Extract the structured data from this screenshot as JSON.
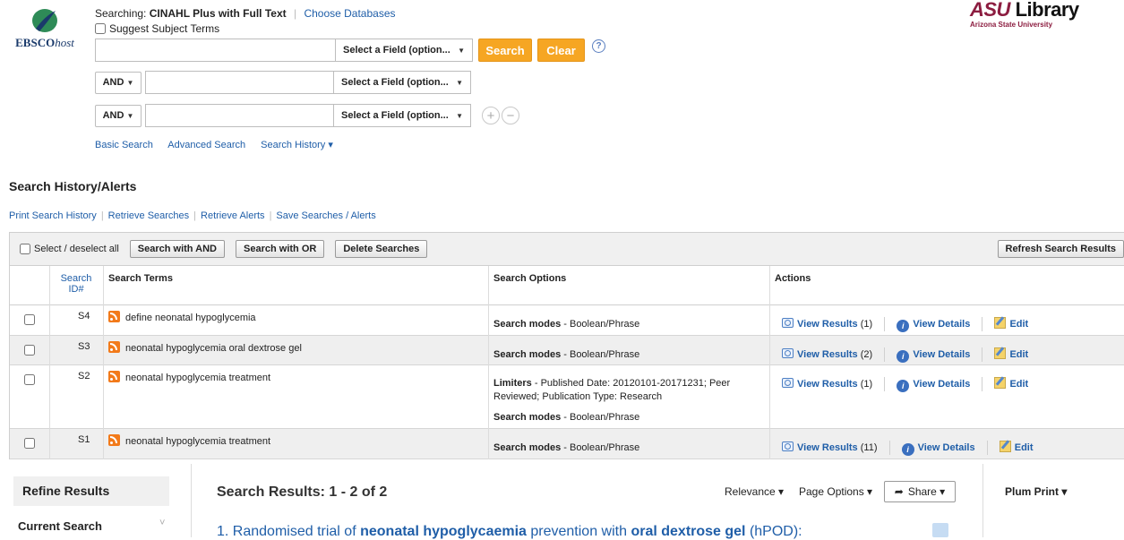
{
  "header": {
    "searching_label": "Searching:",
    "database": "CINAHL Plus with Full Text",
    "choose_databases": "Choose Databases",
    "suggest_subject_terms": "Suggest Subject Terms",
    "logo_text": "EBSCO",
    "logo_text_italic": "host"
  },
  "asu": {
    "logo_asu": "ASU",
    "logo_library": "Library",
    "subtitle": "Arizona State University"
  },
  "search_rows": [
    {
      "bool": "",
      "value": "",
      "field": "Select a Field (option..."
    },
    {
      "bool": "AND",
      "value": "",
      "field": "Select a Field (option..."
    },
    {
      "bool": "AND",
      "value": "",
      "field": "Select a Field (option..."
    }
  ],
  "buttons": {
    "search": "Search",
    "clear": "Clear",
    "help": "?",
    "add": "+",
    "remove": "−"
  },
  "search_links": {
    "basic": "Basic Search",
    "advanced": "Advanced Search",
    "history": "Search History ▾"
  },
  "history": {
    "title": "Search History/Alerts",
    "links": [
      "Print Search History",
      "Retrieve Searches",
      "Retrieve Alerts",
      "Save Searches / Alerts"
    ],
    "select_all": "Select / deselect all",
    "btn_and": "Search with AND",
    "btn_or": "Search with OR",
    "btn_delete": "Delete Searches",
    "btn_refresh": "Refresh Search Results",
    "columns": {
      "id": "Search ID#",
      "terms": "Search Terms",
      "options": "Search Options",
      "actions": "Actions"
    },
    "rows": [
      {
        "id": "S4",
        "terms": "define neonatal hypoglycemia",
        "limiters_label": "",
        "limiters": "",
        "mode_label": "Search modes",
        "mode": " - Boolean/Phrase",
        "view_results": "View Results",
        "count": "(1)",
        "view_details": "View Details",
        "edit": "Edit"
      },
      {
        "id": "S3",
        "terms": "neonatal hypoglycemia oral dextrose gel",
        "limiters_label": "",
        "limiters": "",
        "mode_label": "Search modes",
        "mode": " - Boolean/Phrase",
        "view_results": "View Results",
        "count": "(2)",
        "view_details": "View Details",
        "edit": "Edit"
      },
      {
        "id": "S2",
        "terms": "neonatal hypoglycemia treatment",
        "limiters_label": "Limiters",
        "limiters": " - Published Date: 20120101-20171231; Peer Reviewed; Publication Type: Research",
        "mode_label": "Search modes",
        "mode": " - Boolean/Phrase",
        "view_results": "View Results",
        "count": "(1)",
        "view_details": "View Details",
        "edit": "Edit"
      },
      {
        "id": "S1",
        "terms": "neonatal hypoglycemia treatment",
        "limiters_label": "",
        "limiters": "",
        "mode_label": "Search modes",
        "mode": " - Boolean/Phrase",
        "view_results": "View Results",
        "count": "(11)",
        "view_details": "View Details",
        "edit": "Edit"
      }
    ]
  },
  "results": {
    "refine": "Refine Results",
    "current_search": "Current Search",
    "title": "Search Results: 1 - 2 of 2",
    "relevance": "Relevance ▾",
    "page_options": "Page Options ▾",
    "share": "Share ▾",
    "plum_print": "Plum Print ▾",
    "first_num": "1. ",
    "first_a": "Randomised trial of ",
    "first_b": "neonatal hypoglycaemia",
    "first_c": " prevention with ",
    "first_d": "oral dextrose gel",
    "first_e": " (hPOD):"
  },
  "colors": {
    "accent_orange": "#f6a623",
    "link_blue": "#1f5ea8",
    "asu_maroon": "#8c1d40"
  }
}
